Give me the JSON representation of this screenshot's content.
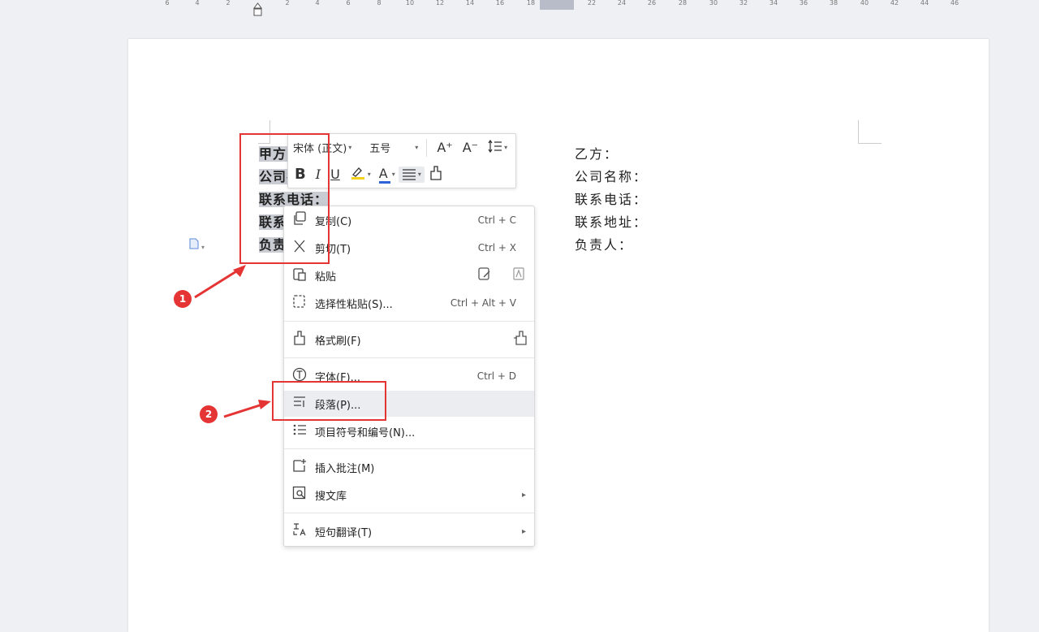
{
  "ruler": {
    "numbers": [
      "6",
      "4",
      "2",
      "2",
      "4",
      "6",
      "8",
      "10",
      "12",
      "14",
      "16",
      "18",
      "22",
      "24",
      "26",
      "28",
      "30",
      "32",
      "34",
      "36",
      "38",
      "40",
      "42",
      "44",
      "46"
    ]
  },
  "document": {
    "left_lines": [
      "甲方：",
      "公司名称：",
      "联系电话：",
      "联系地址：",
      "负责人："
    ],
    "right_lines": [
      "乙方：",
      "公司名称：",
      "联系电话：",
      "联系地址：",
      "负责人："
    ]
  },
  "mini_toolbar": {
    "font_name": "宋体 (正文)",
    "font_size": "五号",
    "grow_font": "A⁺",
    "shrink_font": "A⁻",
    "line_spacing_icon": "line-spacing-icon",
    "bold": "B",
    "italic": "I",
    "underline": "U",
    "font_color": "A",
    "highlight_color": "#f2d21b",
    "font_color_value": "#2f64d8"
  },
  "context_menu": {
    "items": [
      {
        "label": "复制(C)",
        "shortcut": "Ctrl + C",
        "icon": "copy-icon"
      },
      {
        "label": "剪切(T)",
        "shortcut": "Ctrl + X",
        "icon": "scissors-icon"
      },
      {
        "label": "粘贴",
        "shortcut": "",
        "icon": "paste-icon"
      },
      {
        "label": "选择性粘贴(S)...",
        "shortcut": "Ctrl + Alt + V",
        "icon": "paste-special-icon"
      },
      {
        "label": "格式刷(F)",
        "shortcut": "",
        "icon": "format-painter-icon"
      },
      {
        "label": "字体(F)...",
        "shortcut": "Ctrl + D",
        "icon": "font-icon"
      },
      {
        "label": "段落(P)...",
        "shortcut": "",
        "icon": "paragraph-icon"
      },
      {
        "label": "项目符号和编号(N)...",
        "shortcut": "",
        "icon": "bullets-icon"
      },
      {
        "label": "插入批注(M)",
        "shortcut": "",
        "icon": "comment-icon"
      },
      {
        "label": "搜文库",
        "shortcut": "",
        "icon": "search-library-icon"
      },
      {
        "label": "短句翻译(T)",
        "shortcut": "",
        "icon": "translate-icon"
      }
    ]
  },
  "annotations": {
    "badge1": "1",
    "badge2": "2",
    "color": "#e53434"
  }
}
